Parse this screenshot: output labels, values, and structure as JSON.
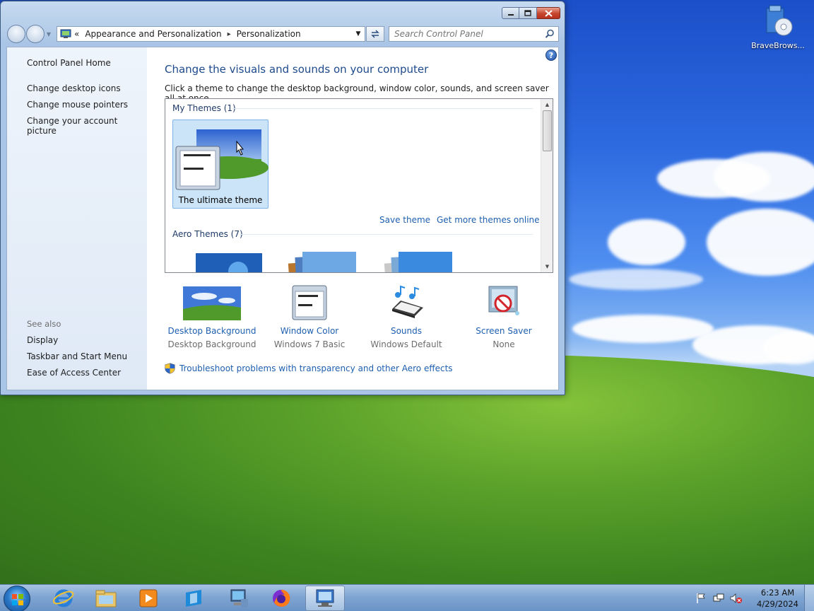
{
  "window": {
    "caption_buttons": {
      "minimize": "minimize-icon",
      "maximize": "maximize-icon",
      "close": "close-icon"
    },
    "address": {
      "prefix": "«",
      "crumbs": [
        "Appearance and Personalization",
        "Personalization"
      ],
      "separator": "▸"
    },
    "search": {
      "placeholder": "Search Control Panel",
      "value": ""
    }
  },
  "leftpane": {
    "links": [
      "Control Panel Home",
      "Change desktop icons",
      "Change mouse pointers",
      "Change your account picture"
    ],
    "see_also_label": "See also",
    "see_also": [
      "Display",
      "Taskbar and Start Menu",
      "Ease of Access Center"
    ]
  },
  "main": {
    "title": "Change the visuals and sounds on your computer",
    "subtitle": "Click a theme to change the desktop background, window color, sounds, and screen saver all at once.",
    "groups": {
      "my_themes": "My Themes (1)",
      "aero_themes": "Aero Themes (7)"
    },
    "selected_theme": "The ultimate theme",
    "save_theme": "Save theme",
    "get_more": "Get more themes online",
    "options": [
      {
        "title": "Desktop Background",
        "value": "Desktop Background",
        "icon": "desktop-background-icon"
      },
      {
        "title": "Window Color",
        "value": "Windows 7 Basic",
        "icon": "window-color-icon"
      },
      {
        "title": "Sounds",
        "value": "Windows Default",
        "icon": "sounds-icon"
      },
      {
        "title": "Screen Saver",
        "value": "None",
        "icon": "screen-saver-icon"
      }
    ],
    "troubleshoot": "Troubleshoot problems with transparency and other Aero effects"
  },
  "desktop": {
    "icons": [
      {
        "label": "BraveBrows...",
        "icon": "installer-icon"
      }
    ]
  },
  "taskbar": {
    "items": [
      "internet-explorer-icon",
      "file-explorer-icon",
      "media-player-icon",
      "app-icon",
      "computer-icon",
      "firefox-icon",
      "control-panel-icon"
    ],
    "tray": [
      "flag-icon",
      "network-icon",
      "volume-muted-icon"
    ],
    "time": "6:23 AM",
    "date": "4/29/2024"
  },
  "colors": {
    "link": "#1e5fb0",
    "title": "#1e4a8c",
    "selected_tile": "#cce4f7"
  }
}
